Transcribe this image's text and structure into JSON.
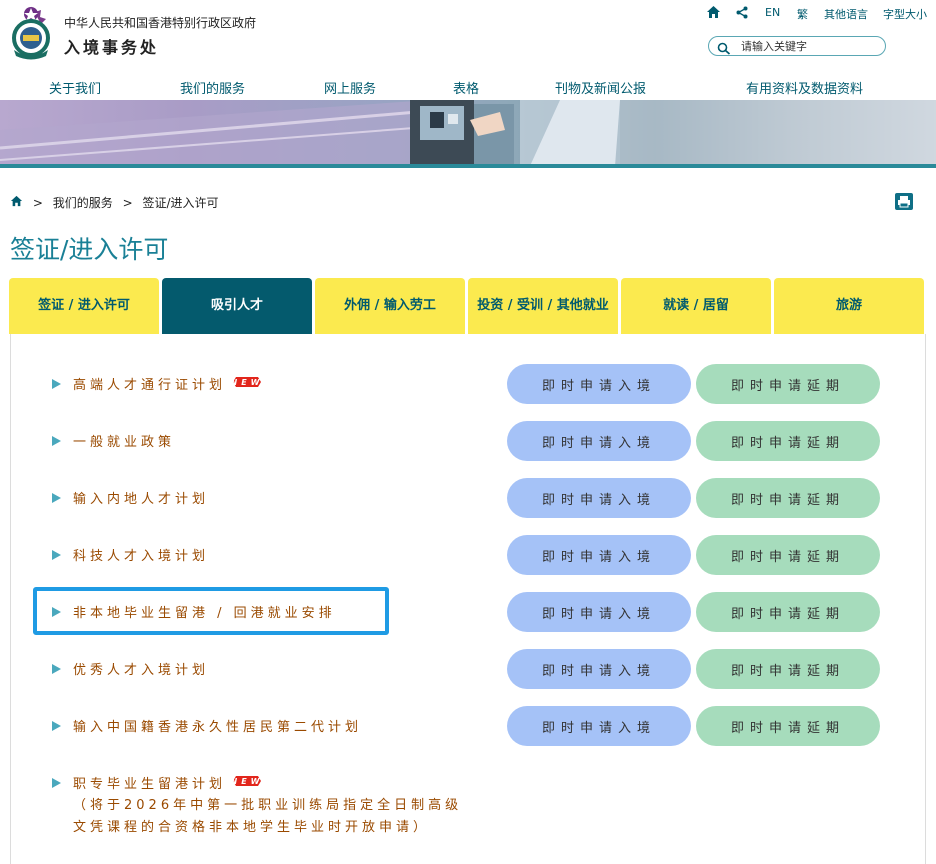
{
  "header": {
    "gov_name": "中华人民共和国香港特别行政区政府",
    "dept_name": "入境事务处",
    "util": {
      "lang_en": "EN",
      "lang_tc": "繁",
      "other_lang": "其他语言",
      "font_size": "字型大小"
    },
    "search_placeholder": "请输入关键字"
  },
  "nav": [
    "关于我们",
    "我们的服务",
    "网上服务",
    "表格",
    "刊物及新闻公报",
    "有用资料及数据资料"
  ],
  "breadcrumb": {
    "sep": ">",
    "items": [
      "我们的服务",
      "签证/进入许可"
    ]
  },
  "page_title": "签证/进入许可",
  "tabs": [
    {
      "label": "签证 / 进入许可",
      "active": false
    },
    {
      "label": "吸引人才",
      "active": true
    },
    {
      "label": "外佣 / 输入劳工",
      "active": false
    },
    {
      "label": "投资 / 受训 / 其他就业",
      "active": false
    },
    {
      "label": "就读 / 居留",
      "active": false
    },
    {
      "label": "旅游",
      "active": false
    }
  ],
  "buttons": {
    "apply_entry": "即时申请入境",
    "apply_extension": "即时申请延期"
  },
  "new_badge": "NEW",
  "schemes": [
    {
      "label": "高端人才通行证计划",
      "new": true
    },
    {
      "label": "一般就业政策",
      "new": false
    },
    {
      "label": "输入内地人才计划",
      "new": false
    },
    {
      "label": "科技人才入境计划",
      "new": false
    },
    {
      "label": "非本地毕业生留港 / 回港就业安排",
      "new": false,
      "highlighted": true
    },
    {
      "label": "优秀人才入境计划",
      "new": false
    },
    {
      "label": "输入中国籍香港永久性居民第二代计划",
      "new": false
    },
    {
      "label": "职专毕业生留港计划",
      "new": true,
      "note_line1": "（将于2026年中第一批职业训练局指定全日制高级",
      "note_line2": "文凭课程的合资格非本地学生毕业时开放申请）"
    }
  ],
  "colors": {
    "accent": "#005a6e",
    "tab_yellow": "#fbea4f",
    "tab_active": "#045a6d",
    "btn_entry": "#a5c2f7",
    "btn_extend": "#a6dcbc",
    "highlight": "#1f9be4",
    "link": "#9a4a00"
  }
}
